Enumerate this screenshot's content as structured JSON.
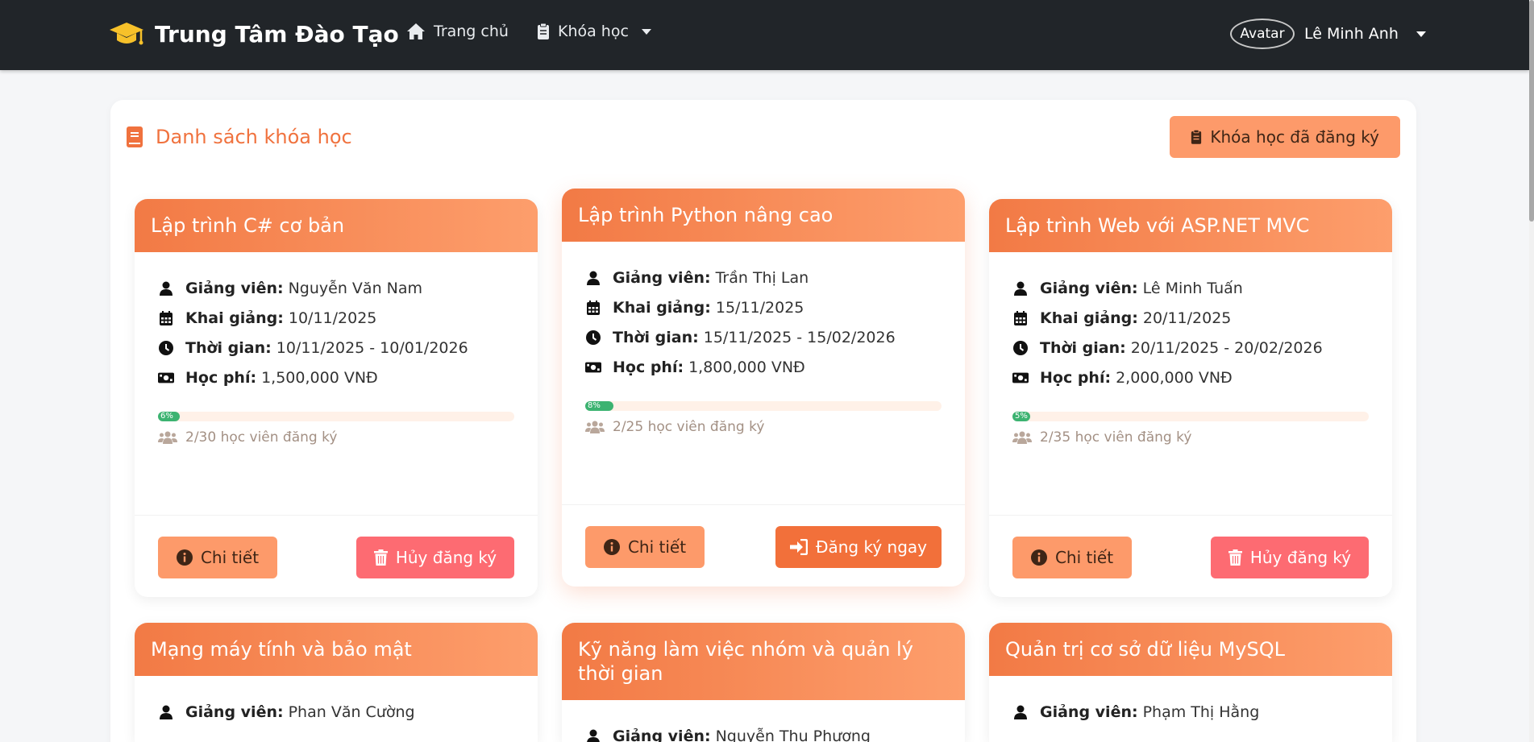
{
  "navbar": {
    "brand": "Trung Tâm Đào Tạo",
    "home": "Trang chủ",
    "courses": "Khóa học",
    "avatar_alt": "Avatar",
    "user_name": "Lê Minh Anh"
  },
  "panel": {
    "title": "Danh sách khóa học",
    "registered_button": "Khóa học đã đăng ký"
  },
  "labels": {
    "instructor": "Giảng viên:",
    "start": "Khai giảng:",
    "duration": "Thời gian:",
    "fee": "Học phí:",
    "detail": "Chi tiết",
    "cancel": "Hủy đăng ký",
    "register": "Đăng ký ngay"
  },
  "courses": [
    {
      "title": "Lập trình C# cơ bản",
      "instructor": "Nguyễn Văn Nam",
      "start": "10/11/2025",
      "duration": "10/11/2025 - 10/01/2026",
      "fee": "1,500,000 VNĐ",
      "progress_label": "6%",
      "progress": 0.06,
      "enroll": "2/30 học viên đăng ký"
    },
    {
      "title": "Lập trình Python nâng cao",
      "instructor": "Trần Thị Lan",
      "start": "15/11/2025",
      "duration": "15/11/2025 - 15/02/2026",
      "fee": "1,800,000 VNĐ",
      "progress_label": "8%",
      "progress": 0.08,
      "enroll": "2/25 học viên đăng ký"
    },
    {
      "title": "Lập trình Web với ASP.NET MVC",
      "instructor": "Lê Minh Tuấn",
      "start": "20/11/2025",
      "duration": "20/11/2025 - 20/02/2026",
      "fee": "2,000,000 VNĐ",
      "progress_label": "5%",
      "progress": 0.05,
      "enroll": "2/35 học viên đăng ký"
    },
    {
      "title": "Mạng máy tính và bảo mật",
      "instructor": "Phan Văn Cường"
    },
    {
      "title": "Kỹ năng làm việc nhóm và quản lý thời gian",
      "instructor": "Nguyễn Thu Phương"
    },
    {
      "title": "Quản trị cơ sở dữ liệu MySQL",
      "instructor": "Phạm Thị Hằng"
    }
  ],
  "colors": {
    "navbar": "#212529",
    "accent": "#f0723e",
    "header_gradient_start": "#f27a45",
    "header_gradient_end": "#fd9e6c",
    "detail_button": "#fd9a6a",
    "cancel_button": "#fd6b72",
    "register_button": "#f2703a",
    "progress": "#3cb371"
  },
  "icons": [
    "graduation-cap-icon",
    "home-icon",
    "clipboard-icon",
    "book-icon",
    "user-icon",
    "calendar-icon",
    "clock-icon",
    "money-icon",
    "users-icon",
    "info-icon",
    "trash-icon",
    "sign-in-icon"
  ]
}
